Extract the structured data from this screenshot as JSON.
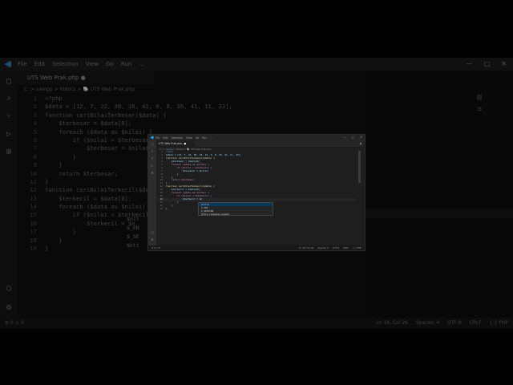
{
  "app": {
    "menu": [
      "File",
      "Edit",
      "Selection",
      "View",
      "Go",
      "Run",
      "..."
    ],
    "window_controls": [
      "—",
      "▢",
      "✕"
    ]
  },
  "tab": {
    "name": "UTS Web Prak.php",
    "modified_marker": "●"
  },
  "breadcrumb": "C: > xampp > htdocs > 🐘 UTS Web Prak.php",
  "code_lines": [
    {
      "n": "1",
      "text": "<?php"
    },
    {
      "n": "2",
      "text": "$data = [12, 7, 22, 30, 18, 41, 6, 8, 36, 41, 11, 23];"
    },
    {
      "n": "3",
      "text": "function cariNilaiTerbesar($data) {"
    },
    {
      "n": "4",
      "text": "    $terbesar = $data[0];"
    },
    {
      "n": "5",
      "text": "    foreach ($data as $nilai) {"
    },
    {
      "n": "6",
      "text": "        if ($nilai > $terbesar) {"
    },
    {
      "n": "7",
      "text": "            $terbesar = $nilai;"
    },
    {
      "n": "8",
      "text": "        }"
    },
    {
      "n": "9",
      "text": "    }"
    },
    {
      "n": "10",
      "text": "    return $terbesar;"
    },
    {
      "n": "11",
      "text": "}"
    },
    {
      "n": "12",
      "text": "function cariNilaiTerkecil($data) {"
    },
    {
      "n": "13",
      "text": "    $terkecil = $data[0];"
    },
    {
      "n": "14",
      "text": "    foreach ($data as $nilai) {"
    },
    {
      "n": "15",
      "text": "        if ($nilai < $terkecil) {"
    },
    {
      "n": "16",
      "text": "            $terkecil = $n"
    },
    {
      "n": "17",
      "text": "        }"
    },
    {
      "n": "18",
      "text": "    }"
    },
    {
      "n": "19",
      "text": "}"
    }
  ],
  "suggestions": [
    "$nilai",
    "$_ENV",
    "$_SESSION",
    "$http_response_header"
  ],
  "bg_suggestions": [
    "$nil",
    "$_EN",
    "$_SE",
    "$htt"
  ],
  "status": {
    "left": "⊗ 0 ⚠ 0",
    "right": [
      "Ln 16, Col 26",
      "Spaces: 4",
      "UTF-8",
      "CRLF",
      "{ } PHP"
    ]
  }
}
